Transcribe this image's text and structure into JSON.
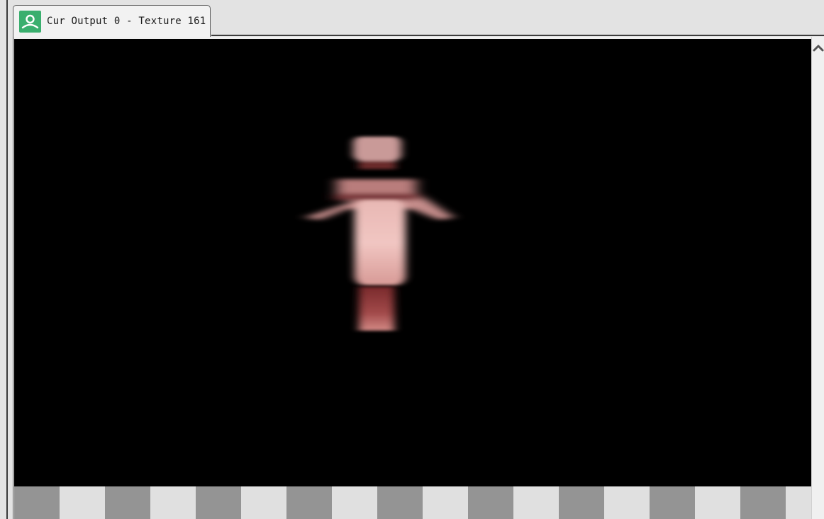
{
  "tab": {
    "title": "Cur Output 0 - Texture 161",
    "icon": "user-icon",
    "icon_color": "#3aaf6e"
  },
  "viewport": {
    "background": "#000000",
    "content": "blurred-figure-texture"
  },
  "checkerboard": {
    "dark": "#949494",
    "light": "#e0e0e0"
  },
  "scrollbar": {
    "up_icon": "chevron-up-icon"
  }
}
